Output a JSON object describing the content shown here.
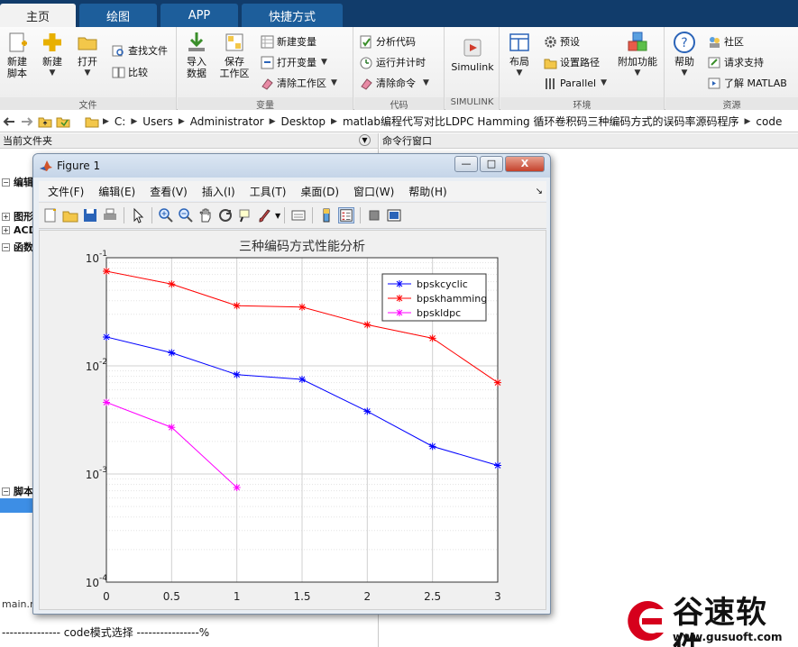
{
  "tabs": [
    {
      "label": "主页",
      "active": true
    },
    {
      "label": "绘图",
      "active": false
    },
    {
      "label": "APP",
      "active": false
    },
    {
      "label": "快捷方式",
      "active": false
    }
  ],
  "ribbon": {
    "file": {
      "label": "文件",
      "new_script": "新建\n脚本",
      "new": "新建",
      "open": "打开",
      "find_files": "查找文件",
      "compare": "比较"
    },
    "variable": {
      "label": "变量",
      "import_data": "导入\n数据",
      "save_workspace": "保存\n工作区",
      "new_variable": "新建变量",
      "open_variable": "打开变量",
      "clear_workspace": "清除工作区"
    },
    "code": {
      "label": "代码",
      "analyze_code": "分析代码",
      "run_and_time": "运行并计时",
      "clear_commands": "清除命令"
    },
    "simulink": {
      "label": "SIMULINK",
      "simulink": "Simulink"
    },
    "environment": {
      "label": "环境",
      "layout": "布局",
      "preferences": "预设",
      "set_path": "设置路径",
      "parallel": "Parallel",
      "addons": "附加功能"
    },
    "resources": {
      "label": "资源",
      "help": "帮助",
      "community": "社区",
      "request_support": "请求支持",
      "learn_matlab": "了解 MATLAB"
    }
  },
  "address": {
    "crumbs": [
      "C:",
      "Users",
      "Administrator",
      "Desktop",
      "matlab编程代写对比LDPC Hamming 循环卷积码三种编码方式的误码率源码程序",
      "code"
    ]
  },
  "current_folder": {
    "header": "当前文件夹",
    "items": [
      "编辑",
      "图形",
      "ACD",
      "函数",
      "脚本"
    ],
    "path_label": "main.r"
  },
  "command_window": {
    "header": "命令行窗口"
  },
  "figure": {
    "title": "Figure 1",
    "menu": [
      "文件(F)",
      "编辑(E)",
      "查看(V)",
      "插入(I)",
      "工具(T)",
      "桌面(D)",
      "窗口(W)",
      "帮助(H)"
    ],
    "min_label": "—",
    "max_label": "□",
    "close_label": "X"
  },
  "command_line": "--------------- code模式选择 ----------------%",
  "watermark": {
    "brand": "谷速软件",
    "url": "www.gusuoft.com"
  },
  "colors": {
    "tab_bar": "#113c6b",
    "blue": "#0000ff",
    "red": "#ff0000",
    "magenta": "#ff00ff"
  },
  "chart_data": {
    "type": "line",
    "title": "三种编码方式性能分析",
    "xlabel": "",
    "ylabel": "",
    "xlim": [
      0,
      3
    ],
    "ylim": [
      0.0001,
      0.1
    ],
    "yscale": "log",
    "grid": true,
    "legend_position": "top-right",
    "x_ticks": [
      "0",
      "0.5",
      "1",
      "1.5",
      "2",
      "2.5",
      "3"
    ],
    "y_ticks": [
      "10",
      "10",
      "10",
      "10"
    ],
    "y_tick_exps": [
      "-1",
      "-2",
      "-3",
      "-4"
    ],
    "series": [
      {
        "name": "bpskcyclic",
        "color": "#0000ff",
        "x": [
          0,
          0.5,
          1,
          1.5,
          2,
          2.5,
          3
        ],
        "y": [
          0.0185,
          0.0132,
          0.0083,
          0.0075,
          0.0038,
          0.0018,
          0.0012
        ]
      },
      {
        "name": "bpskhamming",
        "color": "#ff0000",
        "x": [
          0,
          0.5,
          1,
          1.5,
          2,
          2.5,
          3
        ],
        "y": [
          0.075,
          0.057,
          0.036,
          0.035,
          0.024,
          0.018,
          0.007
        ]
      },
      {
        "name": "bpskldpc",
        "color": "#ff00ff",
        "x": [
          0,
          0.5,
          1
        ],
        "y": [
          0.0046,
          0.0027,
          0.00075
        ]
      }
    ]
  }
}
